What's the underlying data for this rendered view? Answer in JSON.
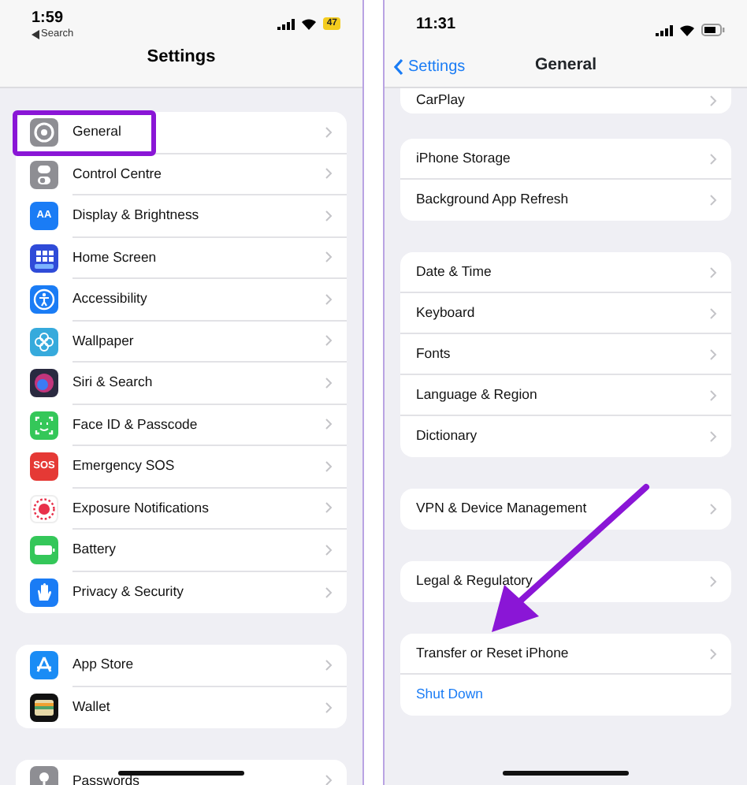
{
  "panels": [
    {
      "status_bar": {
        "time": "1:59",
        "back_label": "Search",
        "battery": "47"
      },
      "title": "Settings",
      "groups": [
        {
          "items": [
            {
              "label": "General",
              "color": "#8e8e93",
              "highlighted": true
            },
            {
              "label": "Control Centre",
              "color": "#8e8e93",
              "highlighted": false
            },
            {
              "label": "Display & Brightness",
              "color": "#1a7cf5",
              "icon_text": "AA",
              "highlighted": false
            },
            {
              "label": "Home Screen",
              "color": "#2f4bd8",
              "highlighted": false
            },
            {
              "label": "Accessibility",
              "color": "#1a7cf5",
              "highlighted": false
            },
            {
              "label": "Wallpaper",
              "color": "#36aadc",
              "highlighted": false
            },
            {
              "label": "Siri & Search",
              "color": "#2a2a40",
              "highlighted": false
            },
            {
              "label": "Face ID & Passcode",
              "color": "#34c759",
              "highlighted": false
            },
            {
              "label": "Emergency SOS",
              "color": "#e53935",
              "icon_text": "SOS",
              "highlighted": false
            },
            {
              "label": "Exposure Notifications",
              "color": "#ffffff",
              "highlighted": false
            },
            {
              "label": "Battery",
              "color": "#34c759",
              "highlighted": false
            },
            {
              "label": "Privacy & Security",
              "color": "#1a7cf5",
              "highlighted": false
            }
          ]
        },
        {
          "items": [
            {
              "label": "App Store",
              "color": "#1a8cf5",
              "highlighted": false
            },
            {
              "label": "Wallet",
              "color": "#111111",
              "highlighted": false
            }
          ]
        },
        {
          "items": [
            {
              "label": "Passwords",
              "color": "#8e8e93",
              "highlighted": false
            }
          ]
        }
      ]
    },
    {
      "status_bar": {
        "time": "11:31"
      },
      "back_button": "Settings",
      "title": "General",
      "groups": [
        {
          "items": [
            {
              "label": "CarPlay",
              "kind": "link"
            }
          ]
        },
        {
          "items": [
            {
              "label": "iPhone Storage",
              "kind": "link"
            },
            {
              "label": "Background App Refresh",
              "kind": "link"
            }
          ]
        },
        {
          "items": [
            {
              "label": "Date & Time",
              "kind": "link"
            },
            {
              "label": "Keyboard",
              "kind": "link"
            },
            {
              "label": "Fonts",
              "kind": "link"
            },
            {
              "label": "Language & Region",
              "kind": "link"
            },
            {
              "label": "Dictionary",
              "kind": "link"
            }
          ]
        },
        {
          "items": [
            {
              "label": "VPN & Device Management",
              "kind": "link"
            }
          ]
        },
        {
          "items": [
            {
              "label": "Legal & Regulatory",
              "kind": "link"
            }
          ]
        },
        {
          "items": [
            {
              "label": "Transfer or Reset iPhone",
              "kind": "link"
            },
            {
              "label": "Shut Down",
              "kind": "action"
            }
          ]
        }
      ]
    }
  ]
}
